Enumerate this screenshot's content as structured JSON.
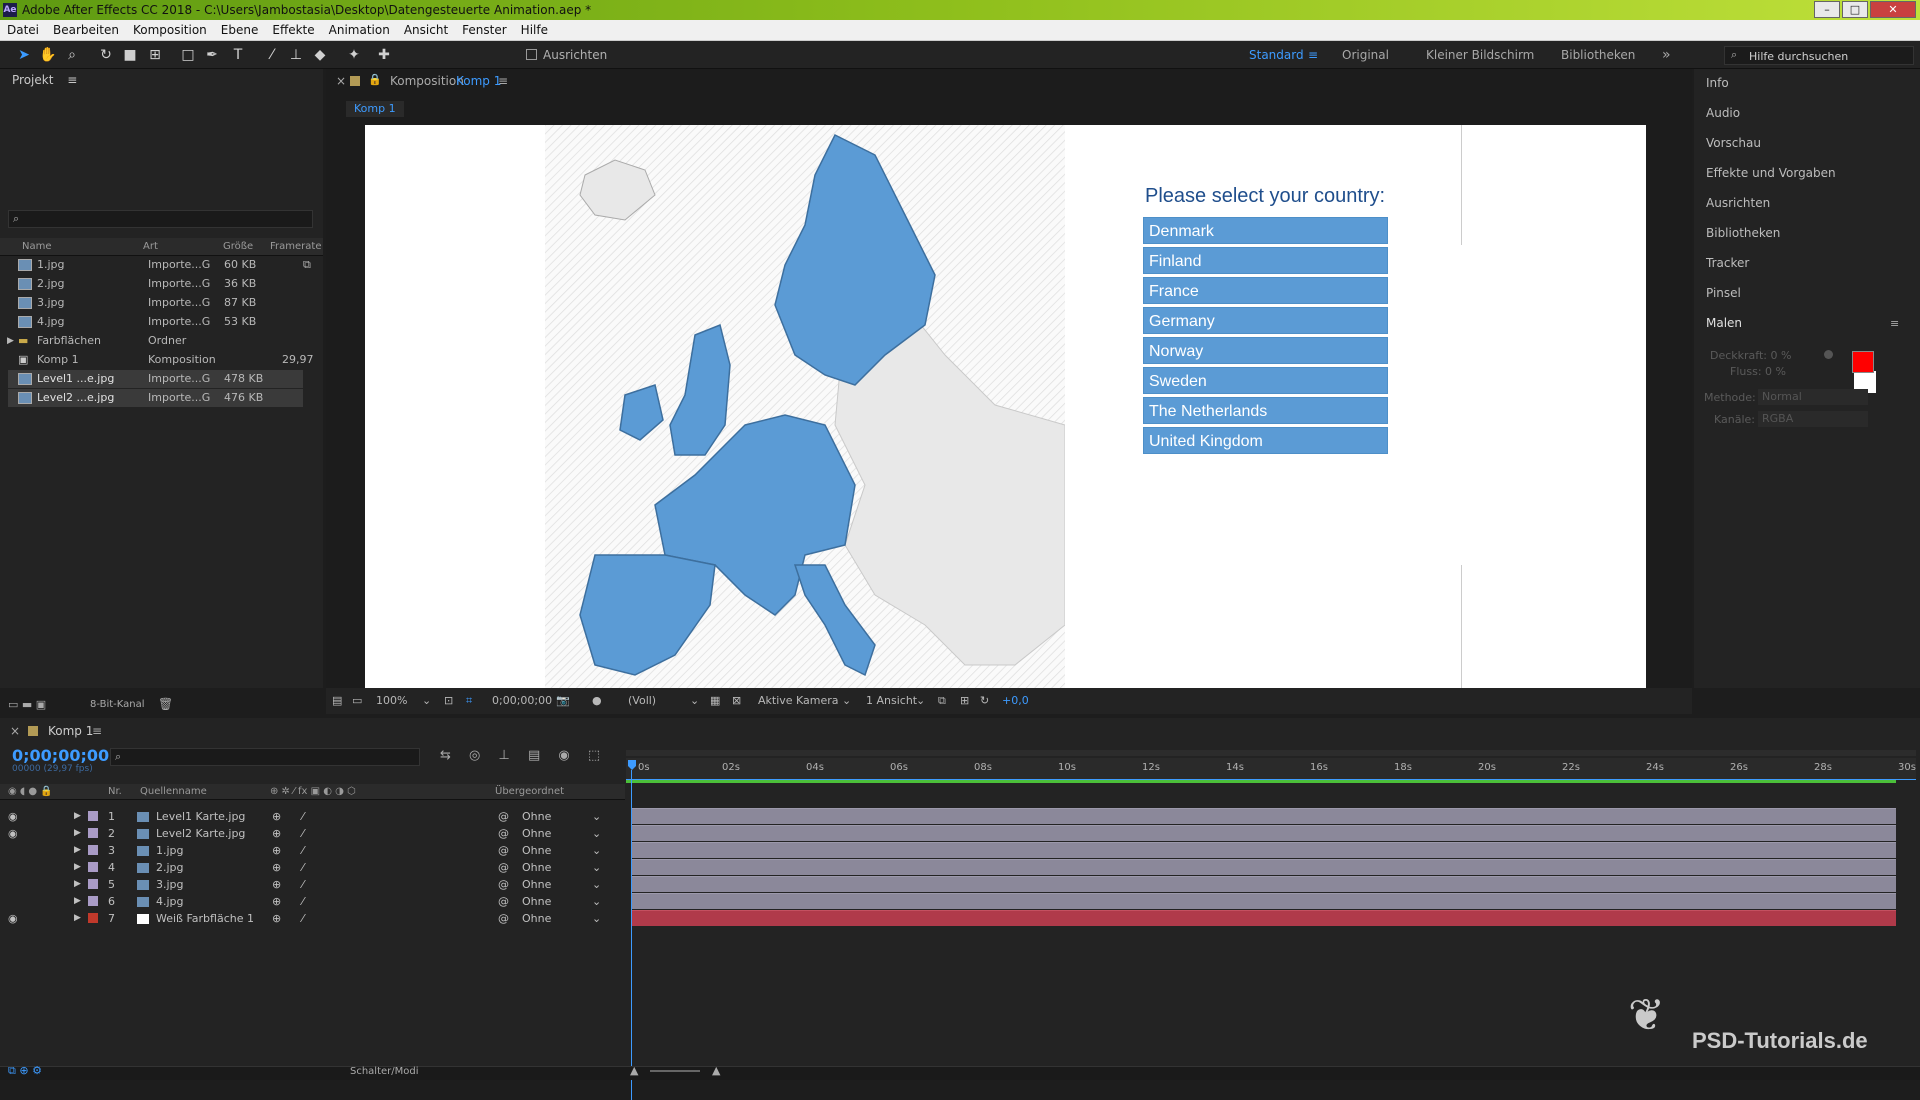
{
  "window": {
    "title": "Adobe After Effects CC 2018 - C:\\Users\\Jambostasia\\Desktop\\Datengesteuerte Animation.aep *",
    "app_icon": "Ae",
    "min": "–",
    "max": "□",
    "close": "✕"
  },
  "menu": [
    "Datei",
    "Bearbeiten",
    "Komposition",
    "Ebene",
    "Effekte",
    "Animation",
    "Ansicht",
    "Fenster",
    "Hilfe"
  ],
  "toolbar": {
    "align_label": "Ausrichten",
    "workspaces": [
      "Standard",
      "Original",
      "Kleiner Bildschirm",
      "Bibliotheken"
    ],
    "search_placeholder": "Hilfe durchsuchen"
  },
  "project": {
    "title": "Projekt",
    "columns": [
      "Name",
      "Art",
      "Größe",
      "Framerate"
    ],
    "items": [
      {
        "name": "1.jpg",
        "type": "Importe...G",
        "size": "60 KB",
        "rate": ""
      },
      {
        "name": "2.jpg",
        "type": "Importe...G",
        "size": "36 KB",
        "rate": ""
      },
      {
        "name": "3.jpg",
        "type": "Importe...G",
        "size": "87 KB",
        "rate": ""
      },
      {
        "name": "4.jpg",
        "type": "Importe...G",
        "size": "53 KB",
        "rate": ""
      },
      {
        "name": "Farbflächen",
        "type": "Ordner",
        "size": "",
        "rate": ""
      },
      {
        "name": "Komp 1",
        "type": "Komposition",
        "size": "",
        "rate": "29,97"
      },
      {
        "name": "Level1 ...e.jpg",
        "type": "Importe...G",
        "size": "478 KB",
        "rate": ""
      },
      {
        "name": "Level2 ...e.jpg",
        "type": "Importe...G",
        "size": "476 KB",
        "rate": ""
      }
    ],
    "bitdepth": "8-Bit-Kanal"
  },
  "viewer": {
    "tab_label": "Komposition",
    "tab_comp": "Komp 1",
    "subtab": "Komp 1",
    "zoom": "100%",
    "timecode": "0;00;00;00",
    "resolution": "(Voll)",
    "camera": "Aktive Kamera",
    "views": "1 Ansicht",
    "exposure": "+0,0"
  },
  "composition": {
    "prompt": "Please select your country:",
    "countries": [
      "Denmark",
      "Finland",
      "France",
      "Germany",
      "Norway",
      "Sweden",
      "The Netherlands",
      "United Kingdom"
    ]
  },
  "right_panel": {
    "items": [
      "Info",
      "Audio",
      "Vorschau",
      "Effekte und Vorgaben",
      "Ausrichten",
      "Bibliotheken",
      "Tracker",
      "Pinsel"
    ],
    "paint": {
      "title": "Malen",
      "opacity": "Deckkraft: 0 %",
      "flow": "Fluss: 0 %",
      "mode_label": "Methode:",
      "mode": "Normal",
      "channel_label": "Kanäle:",
      "channel": "RGBA",
      "fg_color": "#ff0000",
      "bg_color": "#ffffff"
    }
  },
  "timeline": {
    "comp": "Komp 1",
    "timecode": "0;00;00;00",
    "fps": "00000 (29,97 fps)",
    "columns": [
      "Nr.",
      "Quellenname",
      "Übergeordnet"
    ],
    "layers": [
      {
        "nr": "1",
        "name": "Level1 Karte.jpg",
        "parent": "Ohne",
        "visible": true
      },
      {
        "nr": "2",
        "name": "Level2 Karte.jpg",
        "parent": "Ohne",
        "visible": true
      },
      {
        "nr": "3",
        "name": "1.jpg",
        "parent": "Ohne",
        "visible": false
      },
      {
        "nr": "4",
        "name": "2.jpg",
        "parent": "Ohne",
        "visible": false
      },
      {
        "nr": "5",
        "name": "3.jpg",
        "parent": "Ohne",
        "visible": false
      },
      {
        "nr": "6",
        "name": "4.jpg",
        "parent": "Ohne",
        "visible": false
      },
      {
        "nr": "7",
        "name": "Weiß Farbfläche 1",
        "parent": "Ohne",
        "visible": true
      }
    ],
    "ticks": [
      "0s",
      "02s",
      "04s",
      "06s",
      "08s",
      "10s",
      "12s",
      "14s",
      "16s",
      "18s",
      "20s",
      "22s",
      "24s",
      "26s",
      "28s",
      "30s"
    ],
    "bottom_label": "Schalter/Modi"
  },
  "watermark": "PSD-Tutorials.de",
  "colors": {
    "accent": "#2d8ceb",
    "country_fill": "#5b9bd5",
    "layer_bar": "#8b889a",
    "solid_bar": "#b03a4a"
  }
}
